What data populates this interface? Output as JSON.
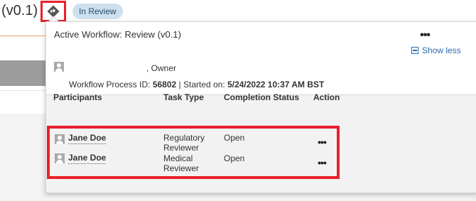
{
  "header": {
    "version": "(v0.1)",
    "workflow_icon": "workflow-diamond-icon",
    "status": "In Review"
  },
  "popover": {
    "title": "Active Workflow: Review (v0.1)",
    "more_icon": "more-horizontal-icon",
    "show_less": "Show less",
    "owner_role": ", Owner",
    "process_id_label": "Workflow Process ID:",
    "process_id": "56802",
    "separator": "|",
    "started_label": "Started on:",
    "started_on": "5/24/2022 10:37 AM BST"
  },
  "table": {
    "headers": [
      "Participants",
      "Task Type",
      "Completion Status",
      "Action"
    ],
    "rows": [
      {
        "participant": "Jane Doe",
        "task_line1": "Regulatory",
        "task_line2": "Reviewer",
        "status": "Open",
        "action": "•••"
      },
      {
        "participant": "Jane Doe",
        "task_line1": "Medical",
        "task_line2": "Reviewer",
        "status": "Open",
        "action": "•••"
      }
    ]
  },
  "colors": {
    "highlight": "#e8202a",
    "link": "#2b6cb0",
    "status_pill_bg": "#cde0f0"
  }
}
